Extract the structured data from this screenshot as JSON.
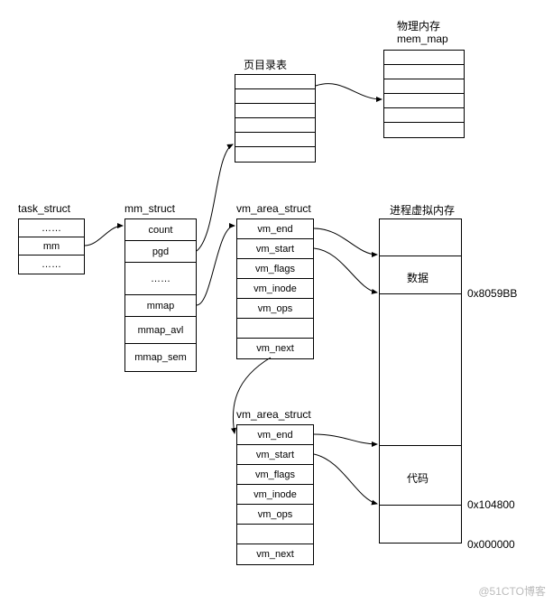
{
  "labels": {
    "task_struct": "task_struct",
    "mm_struct": "mm_struct",
    "vm_area_struct": "vm_area_struct",
    "page_dir_table": "页目录表",
    "phys_mem_title": "物理内存",
    "mem_map": "mem_map",
    "proc_vm_title": "进程虚拟内存",
    "data_region": "数据",
    "code_region": "代码",
    "addr_high": "0x8059BB",
    "addr_mid": "0x104800",
    "addr_low": "0x000000",
    "watermark": "@51CTO博客"
  },
  "task_struct": {
    "rows": [
      "……",
      "mm",
      "……"
    ]
  },
  "mm_struct": {
    "rows": [
      "count",
      "pgd",
      "……",
      "mmap",
      "mmap_avl",
      "mmap_sem"
    ]
  },
  "vm_area_struct": {
    "rows": [
      "vm_end",
      "vm_start",
      "vm_flags",
      "vm_inode",
      "vm_ops",
      "",
      "vm_next"
    ]
  },
  "page_dir": {
    "row_count": 6
  },
  "mem_map_box": {
    "row_count": 6
  }
}
